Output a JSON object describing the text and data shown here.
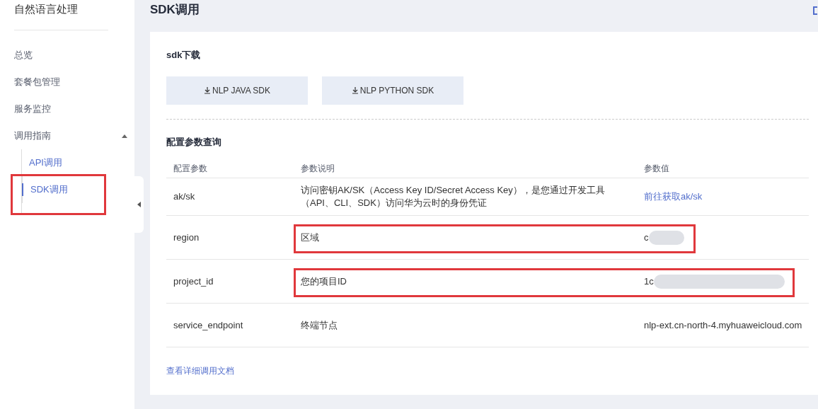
{
  "sidebar": {
    "title": "自然语言处理",
    "items": [
      {
        "label": "总览",
        "selected": false
      },
      {
        "label": "套餐包管理",
        "selected": false
      },
      {
        "label": "服务监控",
        "selected": false
      },
      {
        "label": "调用指南",
        "selected": false,
        "expanded": true,
        "children": [
          {
            "label": "API调用",
            "selected": false,
            "annotated": false
          },
          {
            "label": "SDK调用",
            "selected": true,
            "annotated": true
          }
        ]
      }
    ]
  },
  "page": {
    "title": "SDK调用"
  },
  "download": {
    "title": "sdk下载",
    "buttons": [
      "NLP JAVA SDK",
      "NLP PYTHON SDK"
    ]
  },
  "params": {
    "title": "配置参数查询",
    "columns": [
      "配置参数",
      "参数说明",
      "参数值"
    ],
    "rows": [
      {
        "name": "ak/sk",
        "description": "访问密钥AK/SK（Access Key ID/Secret Access Key），是您通过开发工具（API、CLI、SDK）访问华为云时的身份凭证",
        "value": "前往获取ak/sk",
        "kind": "link",
        "annotated": false
      },
      {
        "name": "region",
        "description": "区域",
        "value": "c",
        "kind": "redacted",
        "annotated": true
      },
      {
        "name": "project_id",
        "description": "您的项目ID",
        "value": "1c",
        "kind": "redacted",
        "annotated": true
      },
      {
        "name": "service_endpoint",
        "description": "终端节点",
        "value": "nlp-ext.cn-north-4.myhuaweicloud.com",
        "kind": "text",
        "annotated": false
      }
    ],
    "doc_link": "查看详细调用文档"
  }
}
